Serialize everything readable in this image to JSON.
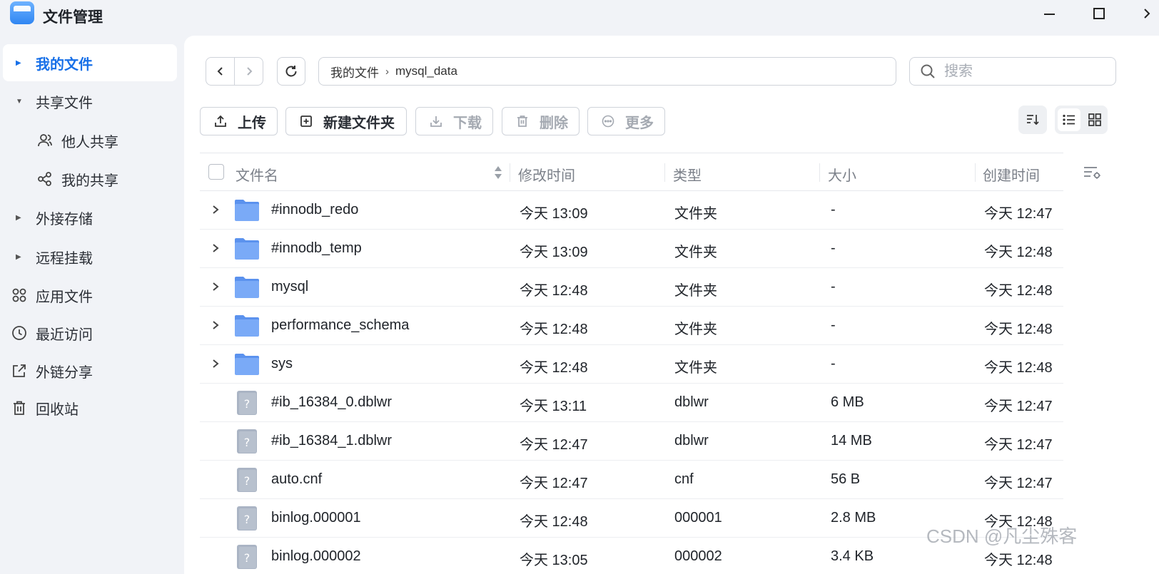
{
  "app": {
    "title": "文件管理"
  },
  "sidebar": {
    "items": [
      {
        "label": "我的文件",
        "icon": "caret-right-icon",
        "active": true
      },
      {
        "label": "共享文件",
        "icon": "caret-down-icon"
      },
      {
        "label": "他人共享",
        "icon": "users-icon",
        "sub": true
      },
      {
        "label": "我的共享",
        "icon": "share-icon",
        "sub": true
      },
      {
        "label": "外接存储",
        "icon": "caret-right-icon"
      },
      {
        "label": "远程挂载",
        "icon": "caret-right-icon"
      },
      {
        "label": "应用文件",
        "icon": "apps-icon"
      },
      {
        "label": "最近访问",
        "icon": "clock-icon"
      },
      {
        "label": "外链分享",
        "icon": "external-link-icon"
      },
      {
        "label": "回收站",
        "icon": "trash-icon"
      }
    ]
  },
  "breadcrumb": {
    "root": "我的文件",
    "current": "mysql_data"
  },
  "search": {
    "placeholder": "搜索"
  },
  "toolbar": {
    "upload": "上传",
    "new_folder": "新建文件夹",
    "download": "下载",
    "delete": "删除",
    "more": "更多"
  },
  "table": {
    "columns": {
      "name": "文件名",
      "modified": "修改时间",
      "type": "类型",
      "size": "大小",
      "created": "创建时间"
    },
    "rows": [
      {
        "name": "#innodb_redo",
        "modified": "今天 13:09",
        "type": "文件夹",
        "size": "-",
        "created": "今天 12:47",
        "kind": "folder"
      },
      {
        "name": "#innodb_temp",
        "modified": "今天 13:09",
        "type": "文件夹",
        "size": "-",
        "created": "今天 12:48",
        "kind": "folder"
      },
      {
        "name": "mysql",
        "modified": "今天 12:48",
        "type": "文件夹",
        "size": "-",
        "created": "今天 12:48",
        "kind": "folder"
      },
      {
        "name": "performance_schema",
        "modified": "今天 12:48",
        "type": "文件夹",
        "size": "-",
        "created": "今天 12:48",
        "kind": "folder"
      },
      {
        "name": "sys",
        "modified": "今天 12:48",
        "type": "文件夹",
        "size": "-",
        "created": "今天 12:48",
        "kind": "folder"
      },
      {
        "name": "#ib_16384_0.dblwr",
        "modified": "今天 13:11",
        "type": "dblwr",
        "size": "6 MB",
        "created": "今天 12:47",
        "kind": "file"
      },
      {
        "name": "#ib_16384_1.dblwr",
        "modified": "今天 12:47",
        "type": "dblwr",
        "size": "14 MB",
        "created": "今天 12:47",
        "kind": "file"
      },
      {
        "name": "auto.cnf",
        "modified": "今天 12:47",
        "type": "cnf",
        "size": "56 B",
        "created": "今天 12:47",
        "kind": "file"
      },
      {
        "name": "binlog.000001",
        "modified": "今天 12:48",
        "type": "000001",
        "size": "2.8 MB",
        "created": "今天 12:48",
        "kind": "file"
      },
      {
        "name": "binlog.000002",
        "modified": "今天 13:05",
        "type": "000002",
        "size": "3.4 KB",
        "created": "今天 12:48",
        "kind": "file"
      }
    ]
  },
  "watermark": "CSDN @凡尘殊客",
  "colors": {
    "accent": "#1870e8",
    "folder": "#6ea3f5",
    "file": "#a9b3c2"
  }
}
